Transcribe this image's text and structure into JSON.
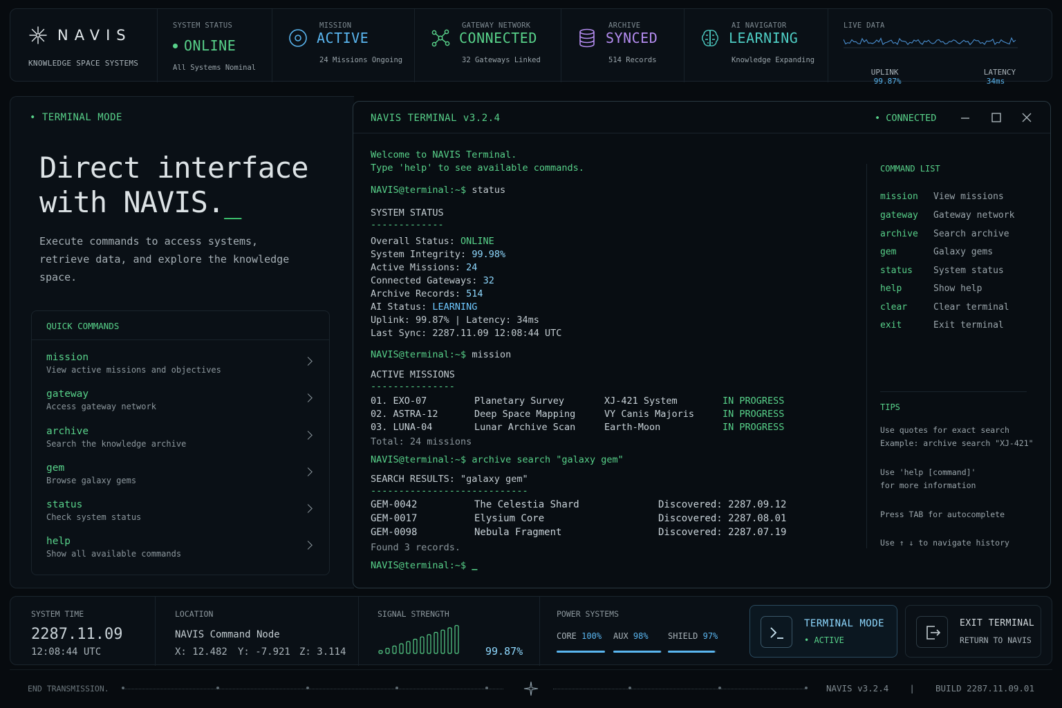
{
  "brand": {
    "name": "NAVIS",
    "subtitle": "KNOWLEDGE SPACE SYSTEMS"
  },
  "status_bar": [
    {
      "label": "SYSTEM STATUS",
      "value": "ONLINE",
      "sub": "All Systems Nominal",
      "color": "#58d28a",
      "icon": "dot-icon"
    },
    {
      "label": "MISSION",
      "value": "ACTIVE",
      "sub": "24 Missions Ongoing",
      "color": "#5ab6f0",
      "icon": "target-icon"
    },
    {
      "label": "GATEWAY NETWORK",
      "value": "CONNECTED",
      "sub": "32 Gateways Linked",
      "color": "#58d28a",
      "icon": "network-icon"
    },
    {
      "label": "ARCHIVE",
      "value": "SYNCED",
      "sub": "514 Records",
      "color": "#b48cf0",
      "icon": "database-icon"
    },
    {
      "label": "AI NAVIGATOR",
      "value": "LEARNING",
      "sub": "Knowledge Expanding",
      "color": "#4ecdc4",
      "icon": "brain-icon"
    }
  ],
  "live_data": {
    "label": "LIVE DATA",
    "uplink_label": "UPLINK",
    "uplink_value": "99.87%",
    "latency_label": "LATENCY",
    "latency_value": "34ms"
  },
  "left": {
    "mode_tag": "• TERMINAL MODE",
    "hero_line1": "Direct interface",
    "hero_line2": "with NAVIS.",
    "hero_cursor": "_",
    "description": "Execute commands to access systems, retrieve data, and explore the knowledge space.",
    "quick_title": "QUICK COMMANDS",
    "quick_commands": [
      {
        "cmd": "mission",
        "desc": "View active missions and objectives"
      },
      {
        "cmd": "gateway",
        "desc": "Access gateway network"
      },
      {
        "cmd": "archive",
        "desc": "Search the knowledge archive"
      },
      {
        "cmd": "gem",
        "desc": "Browse galaxy gems"
      },
      {
        "cmd": "status",
        "desc": "Check system status"
      },
      {
        "cmd": "help",
        "desc": "Show all available commands"
      }
    ]
  },
  "terminal": {
    "title": "NAVIS TERMINAL v3.2.4",
    "connection": "• CONNECTED",
    "welcome1": "Welcome to NAVIS Terminal.",
    "welcome2": "Type 'help' to see available commands.",
    "prompt": "NAVIS@terminal:~$",
    "cmd_status": "status",
    "status_header": "SYSTEM STATUS",
    "status_rule": "-------------",
    "status_lines": [
      {
        "label": "Overall Status: ",
        "value": "ONLINE"
      },
      {
        "label": "System Integrity: ",
        "value": "99.98%"
      },
      {
        "label": "Active Missions: ",
        "value": "24"
      },
      {
        "label": "Connected Gateways: ",
        "value": "32"
      },
      {
        "label": "Archive Records: ",
        "value": "514"
      },
      {
        "label": "AI Status: ",
        "value": "LEARNING"
      }
    ],
    "uplink_line": "Uplink: 99.87% | Latency: 34ms",
    "last_sync": "Last Sync: 2287.11.09 12:08:44 UTC",
    "cmd_mission": "mission",
    "missions_header": "ACTIVE MISSIONS",
    "missions_rule": "---------------",
    "missions": [
      {
        "id": "01. EXO-07",
        "name": "Planetary Survey",
        "system": "XJ-421 System",
        "state": "IN PROGRESS"
      },
      {
        "id": "02. ASTRA-12",
        "name": "Deep Space Mapping",
        "system": "VY Canis Majoris",
        "state": "IN PROGRESS"
      },
      {
        "id": "03. LUNA-04",
        "name": "Lunar Archive Scan",
        "system": "Earth-Moon",
        "state": "IN PROGRESS"
      }
    ],
    "missions_total": "Total: 24 missions",
    "cmd_archive": "archive search \"galaxy gem\"",
    "search_header": "SEARCH RESULTS: \"galaxy gem\"",
    "search_rule": "----------------------------",
    "results": [
      {
        "id": "GEM-0042",
        "name": "The Celestia Shard",
        "found": "Discovered: 2287.09.12"
      },
      {
        "id": "GEM-0017",
        "name": "Elysium Core",
        "found": "Discovered: 2287.08.01"
      },
      {
        "id": "GEM-0098",
        "name": "Nebula Fragment",
        "found": "Discovered: 2287.07.19"
      }
    ],
    "found_count": "Found 3 records.",
    "cursor": "_",
    "command_list_title": "COMMAND LIST",
    "command_list": [
      {
        "cmd": "mission",
        "desc": "View missions"
      },
      {
        "cmd": "gateway",
        "desc": "Gateway network"
      },
      {
        "cmd": "archive",
        "desc": "Search archive"
      },
      {
        "cmd": "gem",
        "desc": "Galaxy gems"
      },
      {
        "cmd": "status",
        "desc": "System status"
      },
      {
        "cmd": "help",
        "desc": "Show help"
      },
      {
        "cmd": "clear",
        "desc": "Clear terminal"
      },
      {
        "cmd": "exit",
        "desc": "Exit terminal"
      }
    ],
    "tips_title": "TIPS",
    "tips": [
      {
        "l1": "Use quotes for exact search",
        "l2": "Example: archive search \"XJ-421\""
      },
      {
        "l1": "Use 'help [command]'",
        "l2": "for more information"
      },
      {
        "l1": "Press TAB for autocomplete",
        "l2": ""
      },
      {
        "l1": "Use ↑ ↓ to navigate history",
        "l2": ""
      }
    ]
  },
  "bottom": {
    "time_label": "SYSTEM TIME",
    "date": "2287.11.09",
    "time": "12:08:44 UTC",
    "location_label": "LOCATION",
    "location_name": "NAVIS Command Node",
    "x": "X: 12.482",
    "y": "Y: -7.921",
    "z": "Z: 3.114",
    "signal_label": "SIGNAL STRENGTH",
    "signal_value": "99.87%",
    "signal_level": 0.9987,
    "power_label": "POWER SYSTEMS",
    "power": [
      {
        "name": "CORE",
        "value": "100%",
        "level": 1.0
      },
      {
        "name": "AUX",
        "value": "98%",
        "level": 0.98
      },
      {
        "name": "SHIELD",
        "value": "97%",
        "level": 0.97
      }
    ],
    "terminal_btn": "TERMINAL MODE",
    "terminal_btn_sub": "• ACTIVE",
    "exit_btn": "EXIT TERMINAL",
    "exit_btn_sub": "RETURN TO NAVIS"
  },
  "footer": {
    "left": "END TRANSMISSION.",
    "version": "NAVIS v3.2.4",
    "divider": "|",
    "build": "BUILD 2287.11.09.01"
  }
}
